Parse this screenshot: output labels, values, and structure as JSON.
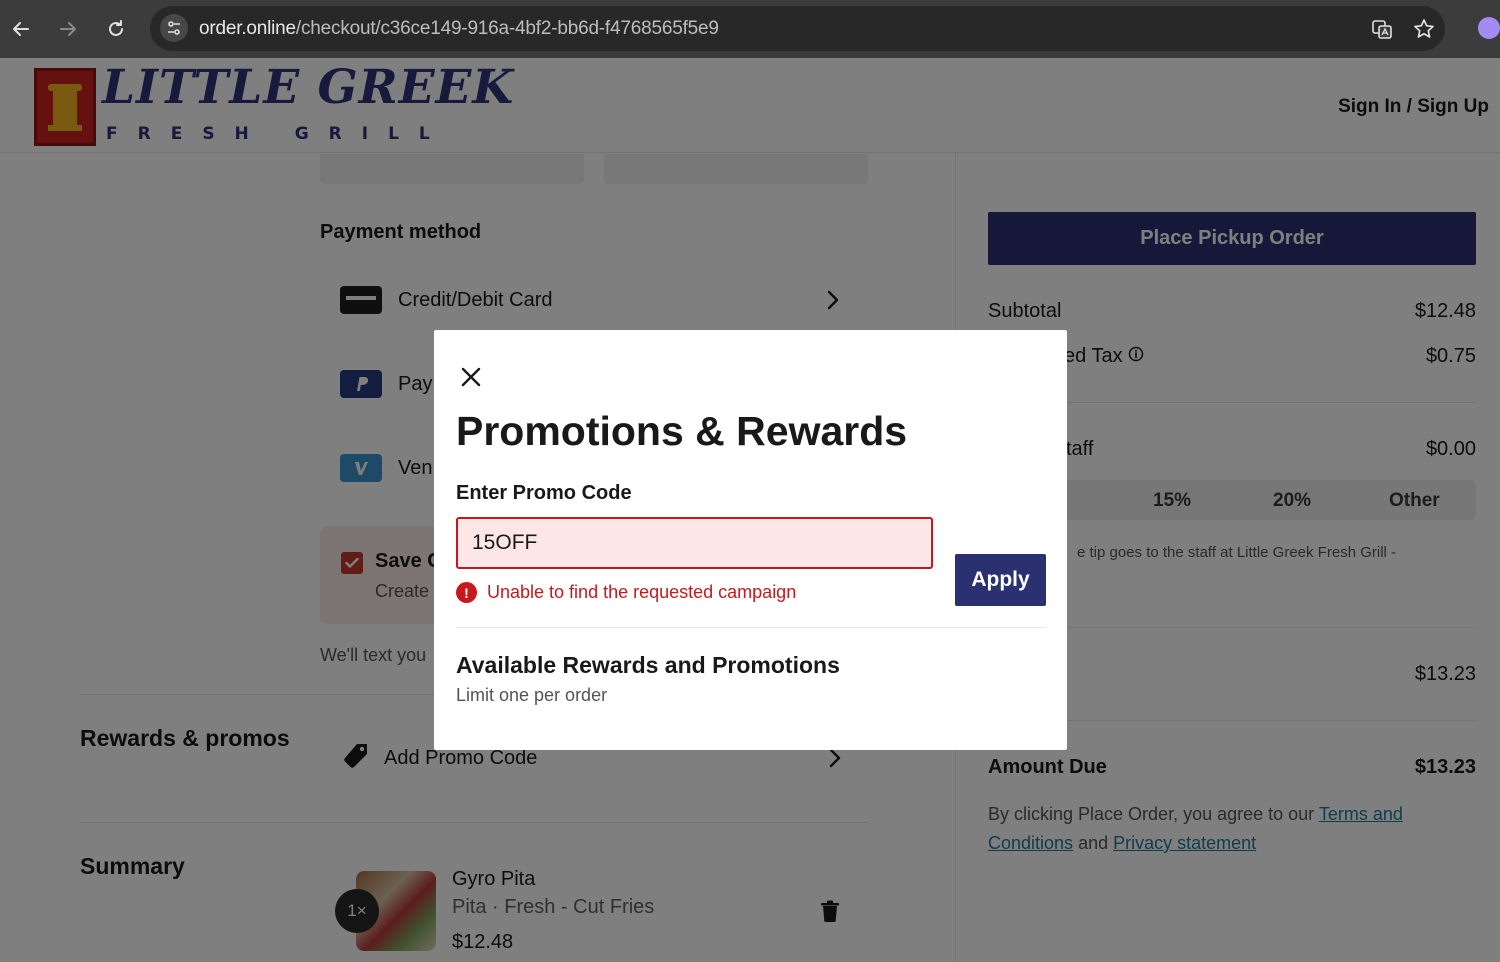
{
  "browser": {
    "url_host": "order.online",
    "url_path": "/checkout/c36ce149-916a-4bf2-bb6d-f4768565f5e9"
  },
  "header": {
    "logo_main": "LITTLE GREEK",
    "logo_sub": "FRESH GRILL",
    "signin_label": "Sign In / Sign Up"
  },
  "payment": {
    "title": "Payment method",
    "methods": [
      {
        "label": "Credit/Debit Card",
        "icon": "credit-card-icon"
      },
      {
        "label": "Pay",
        "icon": "paypal-icon"
      },
      {
        "label": "Ven",
        "icon": "venmo-icon"
      }
    ],
    "save_title": "Save C",
    "save_sub": "Create",
    "text_note": "We'll text you"
  },
  "rewards": {
    "heading": "Rewards & promos",
    "add_promo_label": "Add Promo Code"
  },
  "summary": {
    "heading": "Summary",
    "item": {
      "qty": "1×",
      "name": "Gyro Pita",
      "options": "Pita  · Fresh - Cut Fries",
      "price": "$12.48"
    }
  },
  "order_panel": {
    "place_order_label": "Place Pickup Order",
    "subtotal_label": "Subtotal",
    "subtotal_value": "$12.48",
    "tax_label": "ed Tax",
    "tax_value": "$0.75",
    "tip_label": "taff",
    "tip_value": "$0.00",
    "tip_options": [
      "15%",
      "20%",
      "Other"
    ],
    "tip_note": "e tip goes to the staff at Little Greek Fresh Grill -",
    "total_value": "$13.23",
    "amount_due_label": "Amount Due",
    "amount_due_value": "$13.23",
    "legal_prefix": "By clicking Place Order, you agree to our ",
    "legal_terms": "Terms and Conditions",
    "legal_and": " and ",
    "legal_privacy": "Privacy statement"
  },
  "modal": {
    "title": "Promotions & Rewards",
    "promo_label": "Enter Promo Code",
    "promo_value": "15OFF",
    "apply_label": "Apply",
    "error_message": "Unable to find the requested campaign",
    "available_title": "Available Rewards and Promotions",
    "available_sub": "Limit one per order"
  },
  "colors": {
    "brand_navy": "#2b3170",
    "error_red": "#c8181e",
    "link": "#1e7a9c"
  }
}
